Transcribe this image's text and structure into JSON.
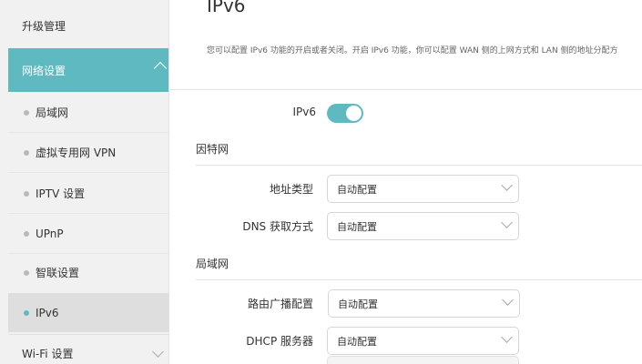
{
  "sidebar": {
    "upgrade_label": "升级管理",
    "network_settings_label": "网络设置",
    "sub_items": [
      {
        "label": "局域网"
      },
      {
        "label": "虚拟专用网 VPN"
      },
      {
        "label": "IPTV 设置"
      },
      {
        "label": "UPnP"
      },
      {
        "label": "智联设置"
      },
      {
        "label": "IPv6"
      }
    ],
    "wifi_label": "Wi-Fi 设置"
  },
  "main": {
    "title": "IPv6",
    "description": "您可以配置 IPv6 功能的开启或者关闭。开启 IPv6 功能，你可以配置 WAN 侧的上网方式和 LAN 侧的地址分配方",
    "ipv6_toggle": {
      "label": "IPv6",
      "state": "on"
    },
    "internet_section": {
      "title": "因特网",
      "address_type": {
        "label": "地址类型",
        "value": "自动配置"
      },
      "dns_method": {
        "label": "DNS 获取方式",
        "value": "自动配置"
      }
    },
    "lan_section": {
      "title": "局域网",
      "router_advert": {
        "label": "路由广播配置",
        "value": "自动配置"
      },
      "dhcp_server": {
        "label": "DHCP 服务器",
        "value": "自动配置"
      }
    }
  },
  "colors": {
    "accent": "#5fb9c1",
    "sidebar_bg": "#f1f1f1",
    "selected_bg": "#dedede"
  }
}
